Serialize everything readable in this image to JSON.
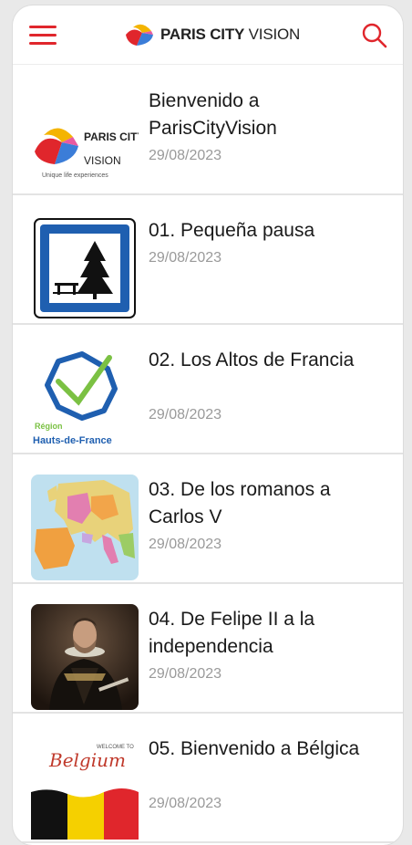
{
  "header": {
    "brand_bold": "PARIS CITY",
    "brand_light": "VISION",
    "menu_icon": "hamburger-menu-icon",
    "search_icon": "search-icon",
    "accent_color": "#e0262c"
  },
  "episodes": [
    {
      "title": "Bienvenido a ParisCityVision",
      "date": "29/08/2023",
      "thumb_logo_bold": "PARIS CITY",
      "thumb_logo_light": "VISION",
      "thumb_tagline": "Unique life experiences"
    },
    {
      "title": "01. Pequeña pausa",
      "date": "29/08/2023"
    },
    {
      "title": "02. Los Altos de Francia",
      "date": "29/08/2023",
      "thumb_label_top": "Région",
      "thumb_label_bottom": "Hauts-de-France"
    },
    {
      "title": "03. De los romanos a Carlos V",
      "date": "29/08/2023"
    },
    {
      "title": "04. De Felipe II a la independencia",
      "date": "29/08/2023"
    },
    {
      "title": "05. Bienvenido a Bélgica",
      "date": "29/08/2023",
      "thumb_label_top": "WELCOME TO",
      "thumb_label_script": "Belgium"
    }
  ]
}
